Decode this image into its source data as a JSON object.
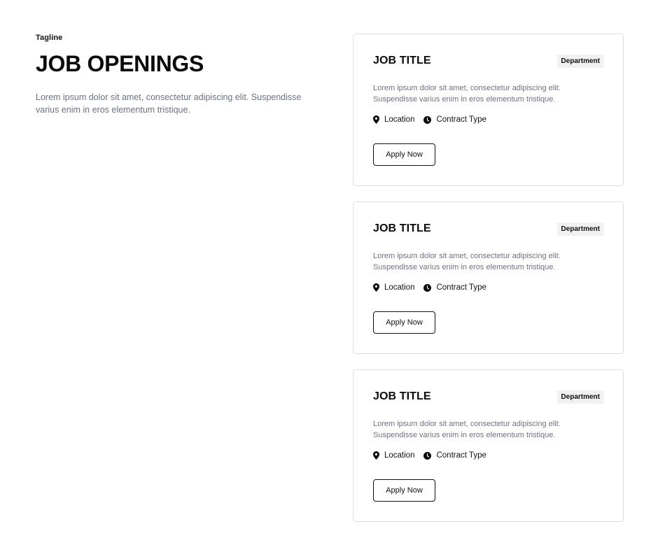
{
  "intro": {
    "tagline": "Tagline",
    "title": "JOB OPENINGS",
    "description": "Lorem ipsum dolor sit amet, consectetur adipiscing elit. Suspendisse varius enim in eros elementum tristique."
  },
  "jobs": [
    {
      "title": "JOB TITLE",
      "department": "Department",
      "description": "Lorem ipsum dolor sit amet, consectetur adipiscing elit. Suspendisse varius enim in eros elementum tristique.",
      "location": "Location",
      "contract": "Contract Type",
      "apply_label": "Apply Now"
    },
    {
      "title": "JOB TITLE",
      "department": "Department",
      "description": "Lorem ipsum dolor sit amet, consectetur adipiscing elit. Suspendisse varius enim in eros elementum tristique.",
      "location": "Location",
      "contract": "Contract Type",
      "apply_label": "Apply Now"
    },
    {
      "title": "JOB TITLE",
      "department": "Department",
      "description": "Lorem ipsum dolor sit amet, consectetur adipiscing elit. Suspendisse varius enim in eros elementum tristique.",
      "location": "Location",
      "contract": "Contract Type",
      "apply_label": "Apply Now"
    }
  ],
  "icons": {
    "location": "map-pin-icon",
    "contract": "clock-icon"
  },
  "colors": {
    "text": "#0b0b0b",
    "muted": "#6b7280",
    "border": "#dcdde0",
    "badge_bg": "#f1f1f2"
  }
}
